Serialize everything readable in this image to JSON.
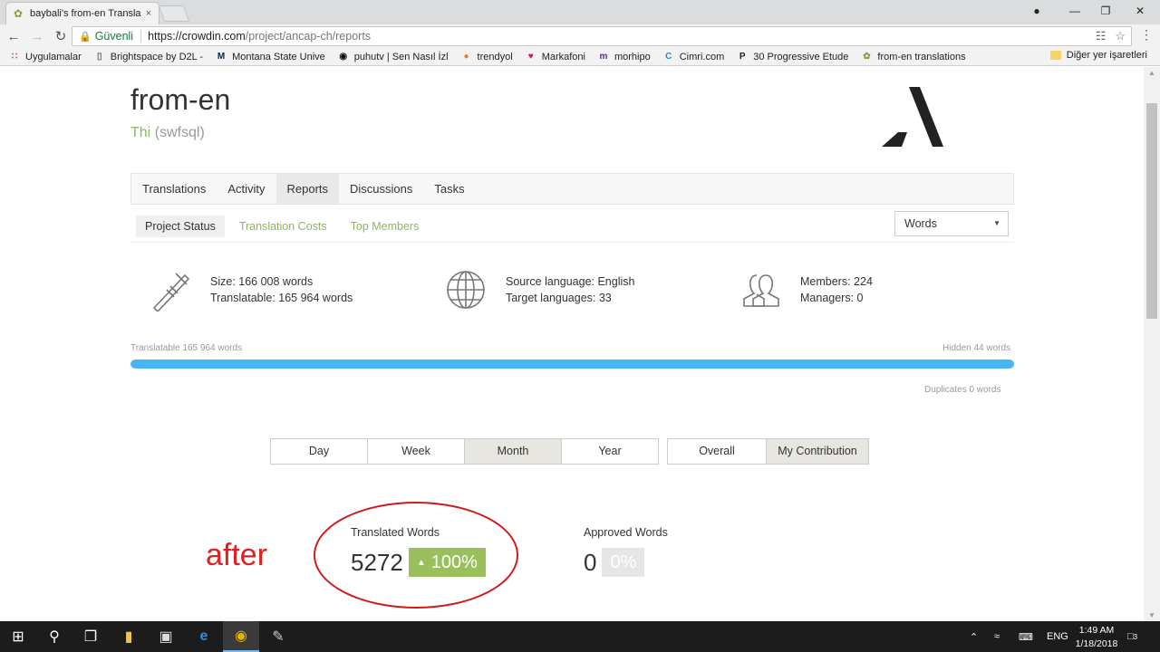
{
  "browser": {
    "tab_title": "baybali's from-en Transla",
    "tab_close": "×",
    "url_secure_label": "Güvenli",
    "url_host": "https://crowdin.com",
    "url_path": "/project/ancap-ch/reports",
    "bookmarks": [
      {
        "label": "Uygulamalar",
        "icon": "apps-grid-icon"
      },
      {
        "label": "Brightspace by D2L -",
        "icon": "page-icon"
      },
      {
        "label": "Montana State Unive",
        "icon": "m-logo-icon"
      },
      {
        "label": "puhutv | Sen Nasıl İzl",
        "icon": "puhutv-icon"
      },
      {
        "label": "trendyol",
        "icon": "trendyol-icon"
      },
      {
        "label": "Markafoni",
        "icon": "markafoni-icon"
      },
      {
        "label": "morhipo",
        "icon": "morhipo-icon"
      },
      {
        "label": "Cimri.com",
        "icon": "cimri-icon"
      },
      {
        "label": "30 Progressive Etude",
        "icon": "p-icon"
      },
      {
        "label": "from-en translations",
        "icon": "crowdin-icon"
      }
    ],
    "other_bookmarks": "Diğer yer işaretleri"
  },
  "project": {
    "title": "from-en",
    "owner_name": "Thi",
    "owner_username": "(swfsql)"
  },
  "nav_tabs": [
    "Translations",
    "Activity",
    "Reports",
    "Discussions",
    "Tasks"
  ],
  "nav_active": "Reports",
  "sub_tabs": [
    "Project Status",
    "Translation Costs",
    "Top Members"
  ],
  "sub_active": "Project Status",
  "unit_select": "Words",
  "stats": {
    "size": "Size: 166 008 words",
    "translatable": "Translatable: 165 964 words",
    "source_language": "Source language: English",
    "target_languages": "Target languages: 33",
    "members": "Members: 224",
    "managers": "Managers: 0"
  },
  "progress": {
    "left_label": "Translatable 165 964 words",
    "right_label": "Hidden 44 words",
    "fill_fraction": 0.9997,
    "duplicates": "Duplicates 0 words"
  },
  "period_buttons": [
    "Day",
    "Week",
    "Month",
    "Year"
  ],
  "period_active": "Month",
  "scope_buttons": [
    "Overall",
    "My Contribution"
  ],
  "scope_active": "My Contribution",
  "annotation": "after",
  "metrics": {
    "translated_label": "Translated Words",
    "translated_value": "5272",
    "translated_pct": "100%",
    "approved_label": "Approved Words",
    "approved_value": "0",
    "approved_pct": "0%"
  },
  "taskbar": {
    "lang": "ENG",
    "time": "1:49 AM",
    "date": "1/18/2018",
    "notif_count": "3"
  },
  "colors": {
    "accent_green": "#8ab861",
    "progress_blue": "#48b5f5",
    "badge_green": "#99c05b",
    "annotation_red": "#e02020"
  }
}
